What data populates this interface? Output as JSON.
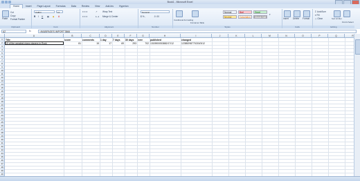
{
  "window": {
    "title": "Book1 - Microsoft Excel"
  },
  "ribbon_tabs": [
    "Home",
    "Insert",
    "Page Layout",
    "Formulas",
    "Data",
    "Review",
    "View",
    "Add-Ins",
    "Hyperion"
  ],
  "ribbon": {
    "clipboard": {
      "label": "Clipboard",
      "paste": "Paste",
      "cut": "Cut",
      "copy": "Copy",
      "format_painter": "Format Painter"
    },
    "font": {
      "label": "Font",
      "name": "Calibri",
      "size": "11"
    },
    "alignment": {
      "label": "Alignment",
      "wrap": "Wrap Text",
      "merge": "Merge & Center"
    },
    "number": {
      "label": "Number",
      "format": "General"
    },
    "styles": {
      "label": "Styles",
      "conditional": "Conditional Formatting",
      "format_table": "Format as Table",
      "cells": [
        {
          "name": "Normal",
          "bg": "#ffffff",
          "fg": "#111111"
        },
        {
          "name": "Bad",
          "bg": "#ffc7ce",
          "fg": "#9c0006"
        },
        {
          "name": "Good",
          "bg": "#c6efce",
          "fg": "#006100"
        },
        {
          "name": "Neutral",
          "bg": "#ffeb9c",
          "fg": "#9c6500"
        },
        {
          "name": "Calculation",
          "bg": "#f2f2f2",
          "fg": "#fa7d00"
        },
        {
          "name": "Check Cell",
          "bg": "#a5a5a5",
          "fg": "#ffffff"
        }
      ]
    },
    "cells": {
      "label": "Cells",
      "insert": "Insert",
      "delete": "Delete",
      "format": "Format"
    },
    "editing": {
      "label": "Editing",
      "autosum": "AutoSum",
      "fill": "Fill",
      "clear": "Clear",
      "sort": "Sort & Filter",
      "find": "Find & Select"
    }
  },
  "formula_bar": {
    "name_box": "A2",
    "fx": "fx",
    "formula": "=IMUBPAGES.IMPORT'3866"
  },
  "columns": [
    "A",
    "B",
    "C",
    "D",
    "E",
    "F",
    "G",
    "H",
    "I",
    "J",
    "K",
    "L",
    "M",
    "N",
    "O",
    "P",
    "Q",
    "R"
  ],
  "rows": [
    "1",
    "2",
    "3",
    "4",
    "5",
    "6",
    "7",
    "8",
    "9",
    "10",
    "11",
    "12",
    "13",
    "14",
    "15",
    "16",
    "17",
    "18",
    "19",
    "20",
    "21",
    "22",
    "23",
    "24",
    "25",
    "26",
    "27",
    "28",
    "29",
    "30",
    "31",
    "32",
    "33",
    "34",
    "35",
    "36",
    "37",
    "38",
    "39",
    "40"
  ],
  "sheet": {
    "headers": [
      "Title",
      "score",
      "comments",
      "1 day",
      "7 days",
      "30 days",
      "ever",
      "published",
      "changed"
    ],
    "row2": [
      "10 of the greatest piano players in Rock",
      "81",
      "15",
      "17",
      "69",
      "293",
      "702",
      "1315900053882/17/12",
      "12385298770215/3/12"
    ]
  }
}
